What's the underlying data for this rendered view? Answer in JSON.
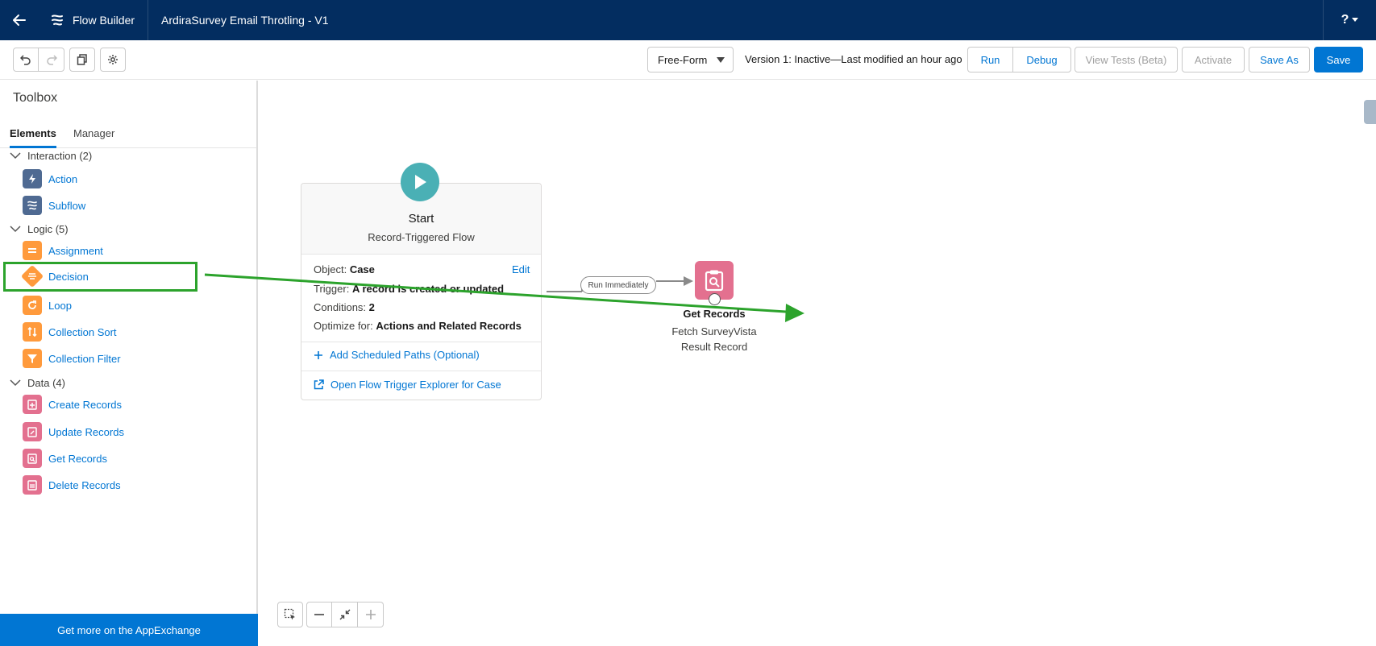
{
  "header": {
    "app_name": "Flow Builder",
    "flow_title": "ArdiraSurvey Email Throtling - V1",
    "help_label": "?"
  },
  "toolbar": {
    "layout_value": "Free-Form",
    "version_text": "Version 1: Inactive—Last modified an hour ago",
    "run_label": "Run",
    "debug_label": "Debug",
    "view_tests_label": "View Tests (Beta)",
    "activate_label": "Activate",
    "save_as_label": "Save As",
    "save_label": "Save"
  },
  "toolbox": {
    "title": "Toolbox",
    "tabs": [
      {
        "label": "Elements",
        "active": true
      },
      {
        "label": "Manager",
        "active": false
      }
    ],
    "categories": [
      {
        "label": "Interaction (2)",
        "items": [
          {
            "label": "Action",
            "icon": "lightning-icon"
          },
          {
            "label": "Subflow",
            "icon": "subflow-icon"
          }
        ]
      },
      {
        "label": "Logic (5)",
        "items": [
          {
            "label": "Assignment",
            "icon": "equals-icon"
          },
          {
            "label": "Decision",
            "icon": "decision-icon"
          },
          {
            "label": "Loop",
            "icon": "loop-icon"
          },
          {
            "label": "Collection Sort",
            "icon": "sort-icon"
          },
          {
            "label": "Collection Filter",
            "icon": "filter-icon"
          }
        ]
      },
      {
        "label": "Data (4)",
        "items": [
          {
            "label": "Create Records",
            "icon": "record-create-icon"
          },
          {
            "label": "Update Records",
            "icon": "record-update-icon"
          },
          {
            "label": "Get Records",
            "icon": "record-lookup-icon"
          },
          {
            "label": "Delete Records",
            "icon": "record-delete-icon"
          }
        ]
      }
    ],
    "appexchange_label": "Get more on the AppExchange"
  },
  "start_node": {
    "title": "Start",
    "subtitle": "Record-Triggered Flow",
    "object_label": "Object:",
    "object_value": "Case",
    "edit_label": "Edit",
    "trigger_label": "Trigger:",
    "trigger_value": "A record is created or updated",
    "conditions_label": "Conditions:",
    "conditions_value": "2",
    "optimize_label": "Optimize for:",
    "optimize_value": "Actions and Related Records",
    "add_paths_label": "Add Scheduled Paths (Optional)",
    "explorer_label": "Open Flow Trigger Explorer for Case"
  },
  "connector": {
    "label": "Run Immediately"
  },
  "get_records_node": {
    "title": "Get Records",
    "subtitle_line1": "Fetch SurveyVista",
    "subtitle_line2": "Result Record"
  },
  "colors": {
    "header_bg": "#032d60",
    "brand_blue": "#0176d3",
    "start_teal": "#4ab0b5",
    "data_pink": "#e3708f",
    "logic_orange": "#ff9a3c",
    "interaction_slate": "#4f6a92",
    "annotation_green": "#2ca32c"
  }
}
